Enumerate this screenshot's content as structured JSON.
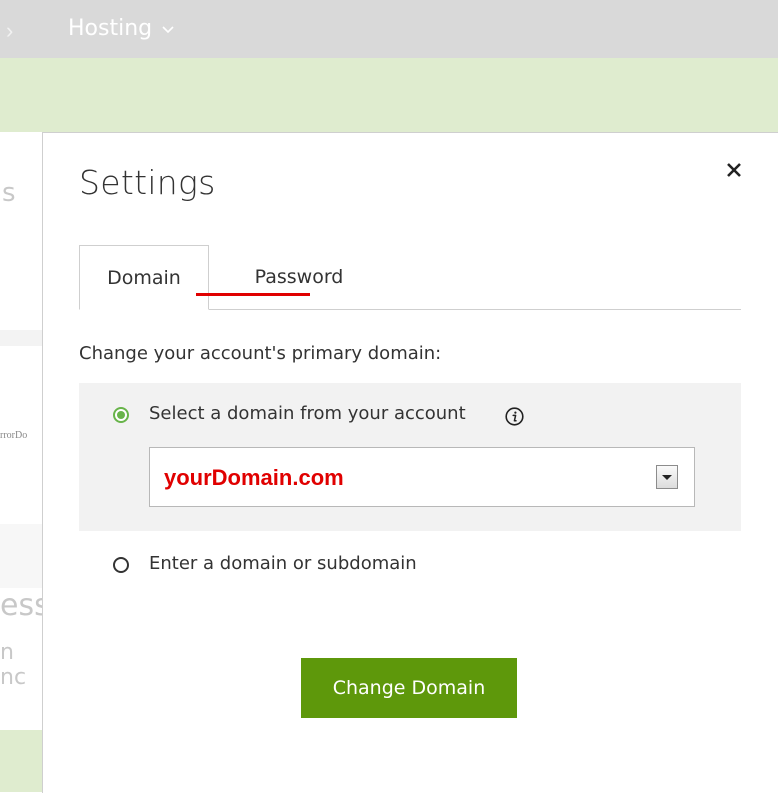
{
  "background": {
    "top_nav": {
      "separator": "›",
      "hosting_label": "Hosting"
    },
    "fragments": {
      "f1": "s",
      "f2": "rrorDo",
      "f3": "ess",
      "f4": "n nc"
    }
  },
  "modal": {
    "title": "Settings",
    "close_icon": "close-icon",
    "tabs": [
      {
        "label": "Domain",
        "active": true
      },
      {
        "label": "Password",
        "active": false
      }
    ],
    "instruction": "Change your account's primary domain:",
    "option_account": {
      "label": "Select a domain from your account",
      "selected": true,
      "info_icon": "info-icon"
    },
    "domain_select": {
      "value": "yourDomain.com"
    },
    "option_custom": {
      "label": "Enter a domain or subdomain",
      "selected": false
    },
    "submit_label": "Change Domain"
  },
  "colors": {
    "accent_green": "#5e980b",
    "radio_green": "#68b44a",
    "annotation_red": "#e00000",
    "nav_gray": "#d9d9d9",
    "band_green": "#dfeccf"
  }
}
